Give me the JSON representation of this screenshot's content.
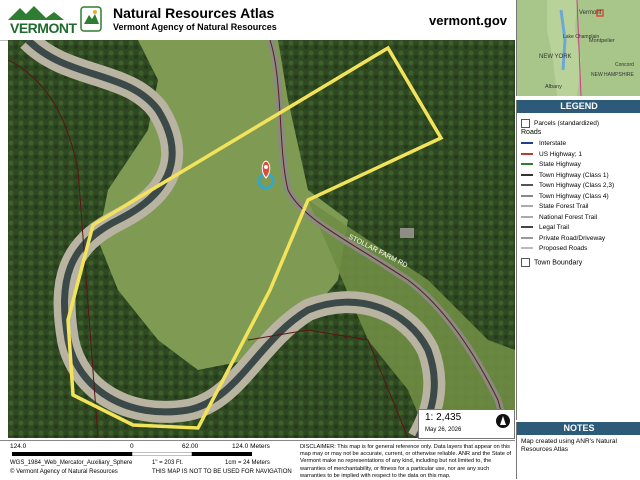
{
  "header": {
    "state_logo_text": "VERMONT",
    "title": "Natural Resources Atlas",
    "subtitle": "Vermont Agency of Natural Resources",
    "site": "vermont.gov"
  },
  "map": {
    "road_label": "STOLLAR FARM RD",
    "parcel_color": "#f2e35a",
    "marker_color": "#e04a3a",
    "location_color": "#2aa8d8"
  },
  "locator": {
    "labels": [
      "Vermont",
      "Lake Champlain",
      "Montpelier",
      "NEW YORK",
      "NEW HAMPSHIRE",
      "Concord",
      "Albany"
    ]
  },
  "legend": {
    "title": "LEGEND",
    "parcels_label": "Parcels (standardized)",
    "roads_label": "Roads",
    "road_items": [
      {
        "label": "Interstate",
        "color": "#1f3f8f"
      },
      {
        "label": "US Highway; 1",
        "color": "#c0392b"
      },
      {
        "label": "State Highway",
        "color": "#2e7d32"
      },
      {
        "label": "Town Highway (Class 1)",
        "color": "#333333"
      },
      {
        "label": "Town Highway (Class 2,3)",
        "color": "#555555"
      },
      {
        "label": "Town Highway (Class 4)",
        "color": "#888888"
      },
      {
        "label": "State Forest Trail",
        "color": "#aaaaaa"
      },
      {
        "label": "National Forest Trail",
        "color": "#aaaaaa"
      },
      {
        "label": "Legal Trail",
        "color": "#444444"
      },
      {
        "label": "Private Road/Driveway",
        "color": "#999999"
      },
      {
        "label": "Proposed Roads",
        "color": "#bbbbbb"
      }
    ],
    "town_boundary_label": "Town Boundary"
  },
  "notes": {
    "title": "NOTES",
    "text": "Map created using ANR's Natural Resources Atlas"
  },
  "scale": {
    "ratio": "1:  2,435",
    "date": "May 26, 2026",
    "bar_left": "124.0",
    "bar_zero": "0",
    "bar_mid": "62.00",
    "bar_right": "124.0 Meters",
    "projection": "WGS_1984_Web_Mercator_Auxiliary_Sphere",
    "inch_ft": "1\" =     203     Ft.",
    "cm_m": "1cm =      24    Meters",
    "copyright": "© Vermont Agency of Natural Resources",
    "not_for_nav": "THIS MAP IS NOT TO BE USED FOR NAVIGATION"
  },
  "disclaimer": "DISCLAIMER: This map is for general reference only. Data layers that appear on this map may or may not be accurate, current, or otherwise reliable. ANR and the State of Vermont make no representations of any kind, including but not limited to, the warranties of merchantability, or fitness for a particular use, nor are any such warranties to be implied with respect to the data on this map."
}
